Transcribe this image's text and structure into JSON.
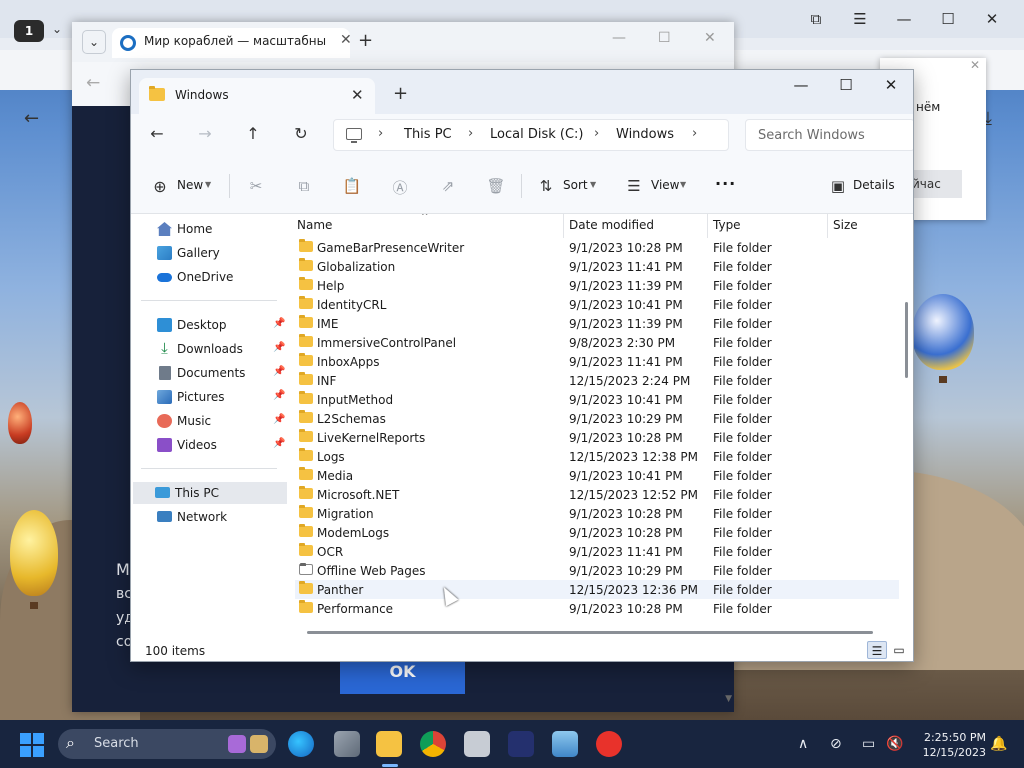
{
  "browser": {
    "tab_count": "1",
    "icons": {
      "collections": "collections-icon",
      "menu": "hamburger-menu-icon",
      "minimize": "minimize-icon",
      "maximize": "maximize-icon",
      "close": "close-icon",
      "back": "back-arrow-icon",
      "download": "download-icon"
    }
  },
  "middle_window": {
    "tab_title": "Мир кораблей — масштабны",
    "content_lines": [
      "М",
      "вс",
      "уд",
      "со"
    ],
    "ok_label": "OK"
  },
  "side_dialog": {
    "text": "нём",
    "button": "йчас"
  },
  "explorer": {
    "tab_title": "Windows",
    "breadcrumbs": [
      "This PC",
      "Local Disk (C:)",
      "Windows"
    ],
    "search_placeholder": "Search Windows",
    "commands": {
      "new": "New",
      "sort": "Sort",
      "view": "View",
      "more": "···",
      "details": "Details"
    },
    "nav": {
      "group1": [
        {
          "label": "Home",
          "icon": "home-icon"
        },
        {
          "label": "Gallery",
          "icon": "gallery-icon"
        },
        {
          "label": "OneDrive",
          "icon": "onedrive-icon"
        }
      ],
      "group2": [
        {
          "label": "Desktop",
          "icon": "desktop-icon"
        },
        {
          "label": "Downloads",
          "icon": "downloads-icon"
        },
        {
          "label": "Documents",
          "icon": "documents-icon"
        },
        {
          "label": "Pictures",
          "icon": "pictures-icon"
        },
        {
          "label": "Music",
          "icon": "music-icon"
        },
        {
          "label": "Videos",
          "icon": "videos-icon"
        }
      ],
      "group3": [
        {
          "label": "This PC",
          "icon": "this-pc-icon"
        },
        {
          "label": "Network",
          "icon": "network-icon"
        }
      ]
    },
    "columns": {
      "name": "Name",
      "date": "Date modified",
      "type": "Type",
      "size": "Size"
    },
    "rows": [
      {
        "name": "GameBarPresenceWriter",
        "date": "9/1/2023 10:28 PM",
        "type": "File folder"
      },
      {
        "name": "Globalization",
        "date": "9/1/2023 11:41 PM",
        "type": "File folder"
      },
      {
        "name": "Help",
        "date": "9/1/2023 11:39 PM",
        "type": "File folder"
      },
      {
        "name": "IdentityCRL",
        "date": "9/1/2023 10:41 PM",
        "type": "File folder"
      },
      {
        "name": "IME",
        "date": "9/1/2023 11:39 PM",
        "type": "File folder"
      },
      {
        "name": "ImmersiveControlPanel",
        "date": "9/8/2023 2:30 PM",
        "type": "File folder"
      },
      {
        "name": "InboxApps",
        "date": "9/1/2023 11:41 PM",
        "type": "File folder"
      },
      {
        "name": "INF",
        "date": "12/15/2023 2:24 PM",
        "type": "File folder"
      },
      {
        "name": "InputMethod",
        "date": "9/1/2023 10:41 PM",
        "type": "File folder"
      },
      {
        "name": "L2Schemas",
        "date": "9/1/2023 10:29 PM",
        "type": "File folder"
      },
      {
        "name": "LiveKernelReports",
        "date": "9/1/2023 10:28 PM",
        "type": "File folder"
      },
      {
        "name": "Logs",
        "date": "12/15/2023 12:38 PM",
        "type": "File folder"
      },
      {
        "name": "Media",
        "date": "9/1/2023 10:41 PM",
        "type": "File folder"
      },
      {
        "name": "Microsoft.NET",
        "date": "12/15/2023 12:52 PM",
        "type": "File folder"
      },
      {
        "name": "Migration",
        "date": "9/1/2023 10:28 PM",
        "type": "File folder"
      },
      {
        "name": "ModemLogs",
        "date": "9/1/2023 10:28 PM",
        "type": "File folder"
      },
      {
        "name": "OCR",
        "date": "9/1/2023 11:41 PM",
        "type": "File folder"
      },
      {
        "name": "Offline Web Pages",
        "date": "9/1/2023 10:29 PM",
        "type": "File folder"
      },
      {
        "name": "Panther",
        "date": "12/15/2023 12:36 PM",
        "type": "File folder"
      },
      {
        "name": "Performance",
        "date": "9/1/2023 10:28 PM",
        "type": "File folder"
      }
    ],
    "status": "100 items"
  },
  "taskbar": {
    "search_label": "Search",
    "time": "2:25:50 PM",
    "date": "12/15/2023"
  }
}
